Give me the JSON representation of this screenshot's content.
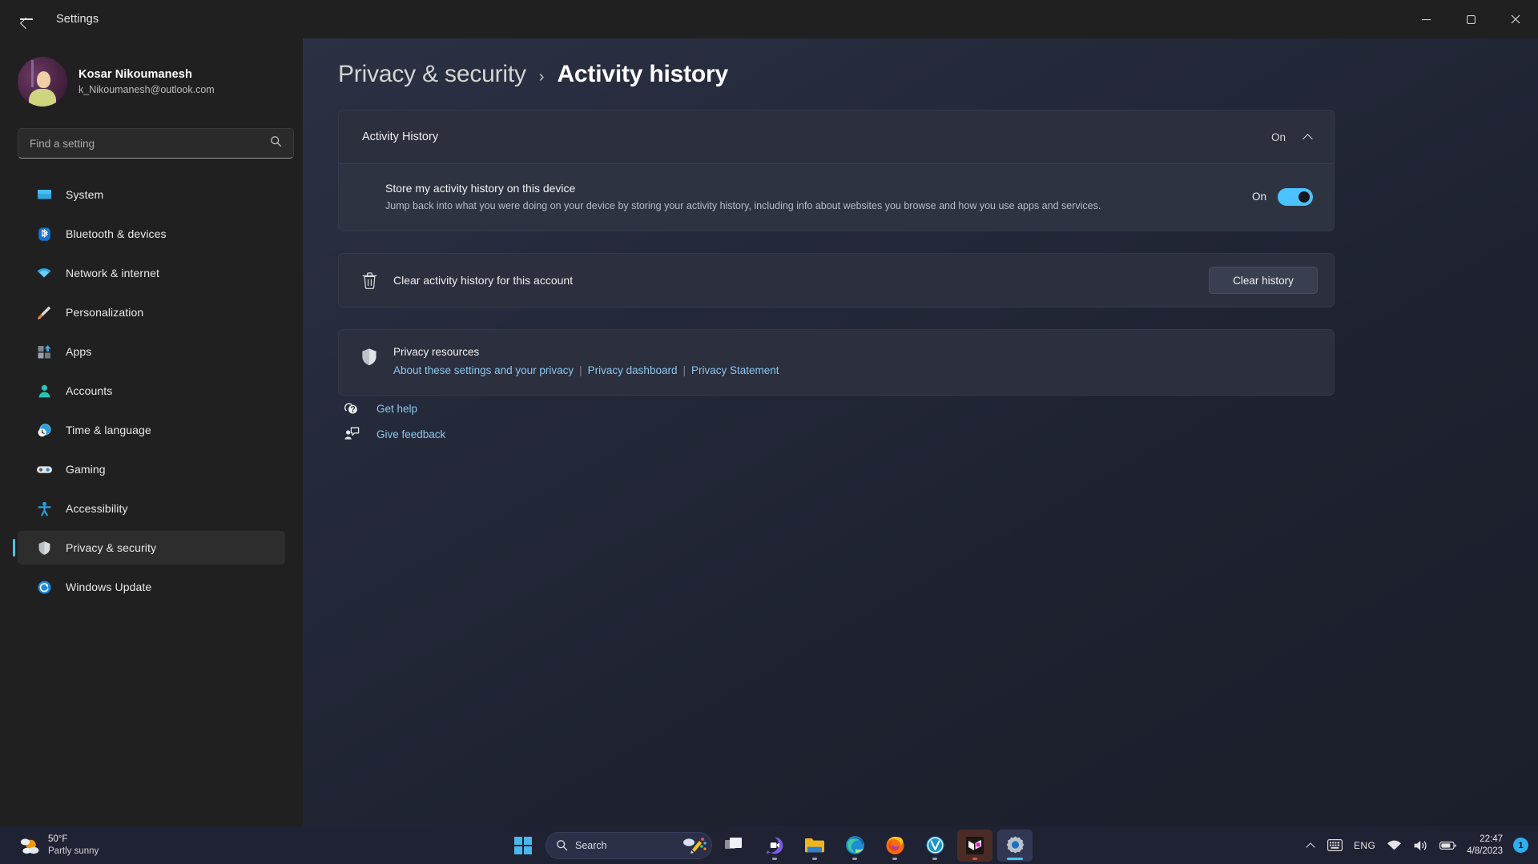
{
  "window": {
    "title": "Settings",
    "back_label": "Back",
    "minimize_label": "Minimize",
    "restore_label": "Restore",
    "close_label": "Close"
  },
  "account": {
    "name": "Kosar Nikoumanesh",
    "email": "k_Nikoumanesh@outlook.com"
  },
  "search": {
    "placeholder": "Find a setting",
    "value": "",
    "icon": "search-icon"
  },
  "sidebar": {
    "items": [
      {
        "label": "System",
        "icon": "display-icon"
      },
      {
        "label": "Bluetooth & devices",
        "icon": "bluetooth-icon"
      },
      {
        "label": "Network & internet",
        "icon": "wifi-icon"
      },
      {
        "label": "Personalization",
        "icon": "paintbrush-icon"
      },
      {
        "label": "Apps",
        "icon": "apps-icon"
      },
      {
        "label": "Accounts",
        "icon": "person-icon"
      },
      {
        "label": "Time & language",
        "icon": "clock-globe-icon"
      },
      {
        "label": "Gaming",
        "icon": "gamepad-icon"
      },
      {
        "label": "Accessibility",
        "icon": "accessibility-icon"
      },
      {
        "label": "Privacy & security",
        "icon": "shield-icon",
        "active": true
      },
      {
        "label": "Windows Update",
        "icon": "update-icon"
      }
    ]
  },
  "breadcrumb": {
    "parent": "Privacy & security",
    "separator": "›",
    "current": "Activity history"
  },
  "activity_history": {
    "expander_title": "Activity History",
    "expander_state": "On",
    "expander_chevron": "chevron-up-icon",
    "store": {
      "title": "Store my activity history on this device",
      "description": "Jump back into what you were doing on your device by storing your activity history, including info about websites you browse and how you use apps and services.",
      "toggle_label": "On",
      "toggle_on": true
    }
  },
  "clear_history": {
    "icon": "trash-icon",
    "label": "Clear activity history for this account",
    "button_label": "Clear history"
  },
  "privacy_resources": {
    "icon": "shield-icon",
    "title": "Privacy resources",
    "links": [
      "About these settings and your privacy",
      "Privacy dashboard",
      "Privacy Statement"
    ],
    "separator": "|"
  },
  "footer_links": [
    {
      "label": "Get help",
      "icon": "help-icon"
    },
    {
      "label": "Give feedback",
      "icon": "feedback-icon"
    }
  ],
  "taskbar": {
    "weather": {
      "temperature": "50°F",
      "condition": "Partly sunny",
      "icon": "partly-sunny-icon"
    },
    "start_label": "Start",
    "search": {
      "placeholder": "Search",
      "icon": "search-icon"
    },
    "apps": [
      {
        "name": "task-view",
        "label": "Task view"
      },
      {
        "name": "chat",
        "label": "Chat"
      },
      {
        "name": "file-explorer",
        "label": "File Explorer"
      },
      {
        "name": "edge",
        "label": "Microsoft Edge"
      },
      {
        "name": "firefox",
        "label": "Firefox"
      },
      {
        "name": "vidyo",
        "label": "V App"
      },
      {
        "name": "dark-app",
        "label": "Pinned app"
      },
      {
        "name": "settings",
        "label": "Settings",
        "active": true
      }
    ],
    "tray": {
      "overflow_label": "Show hidden icons",
      "keyboard_label": "Touch keyboard",
      "language": "ENG",
      "network_label": "Network",
      "volume_label": "Volume",
      "battery_label": "Battery",
      "time": "22:47",
      "date": "4/8/2023",
      "notification_count": "1"
    }
  },
  "colors": {
    "accent": "#4cc2ff",
    "link": "#8cc7ee",
    "sidebar_bg": "#202020",
    "card_bg": "#2b2f3e"
  }
}
